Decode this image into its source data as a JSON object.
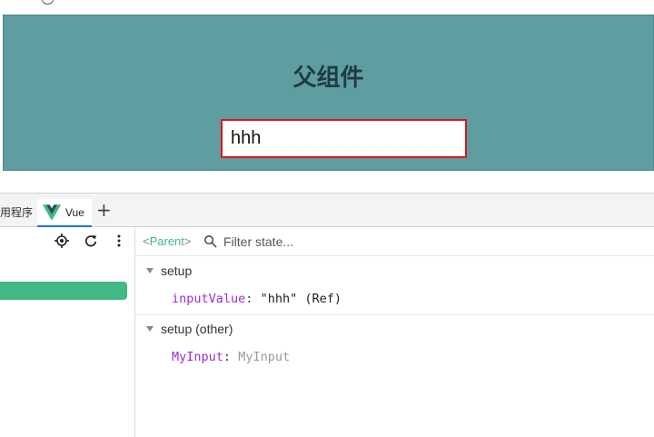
{
  "app": {
    "parent_title": "父组件",
    "input_value": "hhh"
  },
  "devtools": {
    "tabs": [
      {
        "label": "用程序"
      },
      {
        "label": "Vue"
      }
    ],
    "add_tab_label": "+",
    "selected_component": {
      "open": "<",
      "name": "Parent",
      "close": ">"
    },
    "filter_placeholder": "Filter state...",
    "sections": [
      {
        "title": "setup",
        "rows": [
          {
            "key": "inputValue",
            "sep": ":",
            "value": "\"hhh\" (Ref)"
          }
        ]
      },
      {
        "title": "setup (other)",
        "rows": [
          {
            "key": "MyInput",
            "sep": ":",
            "value": "MyInput"
          }
        ]
      }
    ],
    "colors": {
      "vue_green": "#42b883",
      "parent_bg": "#5f9ea0",
      "input_border": "#e0141a",
      "key_purple": "#9a2ed1"
    },
    "icons": [
      "target-icon",
      "refresh-icon",
      "more-vertical-icon",
      "search-icon",
      "vue-logo-icon"
    ]
  }
}
